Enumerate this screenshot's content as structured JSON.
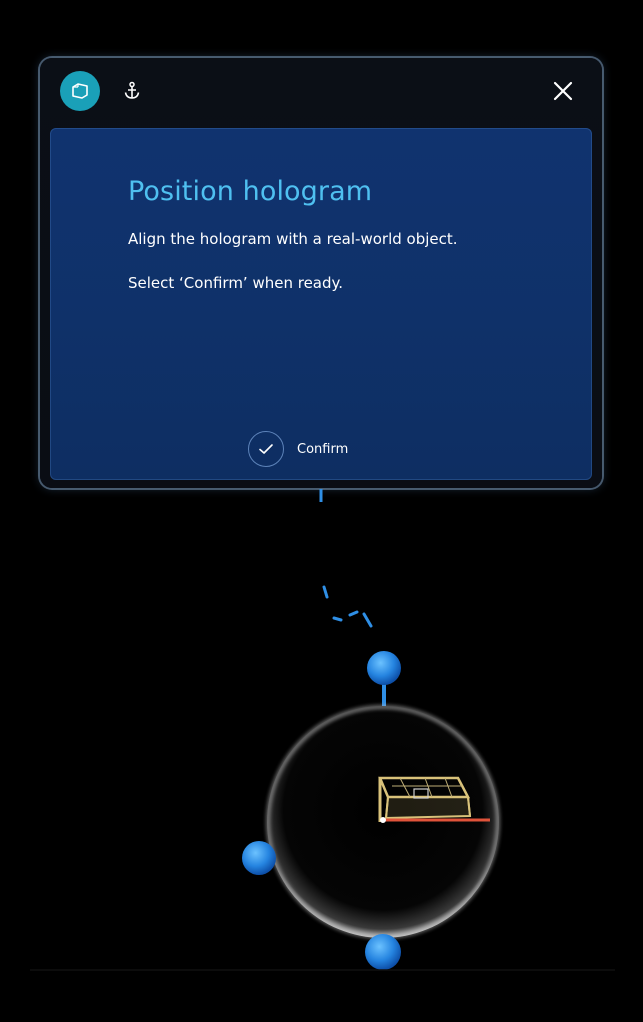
{
  "dialog": {
    "app_icon": "hologram-cube-icon",
    "anchor_icon": "anchor-icon",
    "close_icon": "close-icon",
    "title": "Position hologram",
    "instruction": "Align the hologram with a real-world object.",
    "hint": "Select ‘Confirm’ when ready.",
    "confirm_label": "Confirm",
    "confirm_icon": "checkmark-icon"
  },
  "colors": {
    "accent": "#4fc0f0",
    "panel": "#10336f",
    "app_icon_bg": "#1aa0b8",
    "handle": "#2f8fe6",
    "model_frame": "#d9c27a",
    "model_rail": "#e0533a"
  },
  "scene": {
    "handles": [
      "rotate-handle",
      "scale-handle-left",
      "move-handle-bottom"
    ],
    "model": "gantry-model-hologram"
  }
}
